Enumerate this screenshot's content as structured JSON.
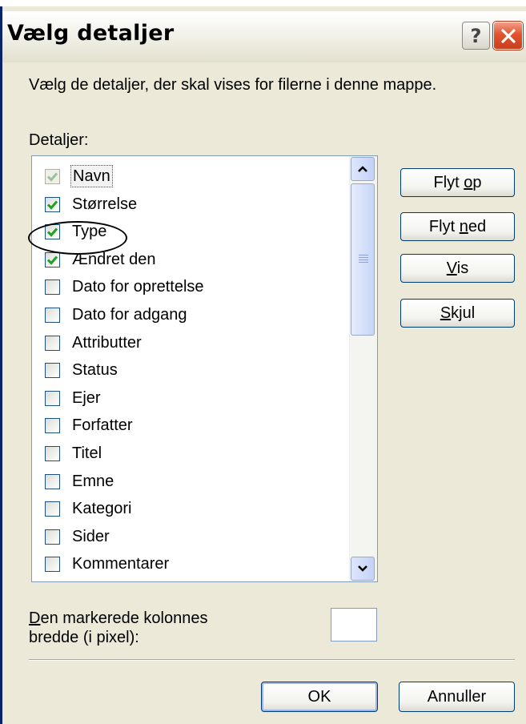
{
  "window": {
    "title": "Vælg detaljer",
    "help_label": "?",
    "close_icon": "close-icon"
  },
  "description": "Vælg de detaljer, der skal  vises for filerne i denne mappe.",
  "details_label": "Detaljer:",
  "details_list": [
    {
      "label": "Navn",
      "checked": true,
      "disabled": true,
      "selected": true
    },
    {
      "label": "Størrelse",
      "checked": true
    },
    {
      "label": "Type",
      "checked": true
    },
    {
      "label": "Ændret den",
      "checked": true
    },
    {
      "label": "Dato for oprettelse",
      "checked": false
    },
    {
      "label": "Dato for adgang",
      "checked": false
    },
    {
      "label": "Attributter",
      "checked": false
    },
    {
      "label": "Status",
      "checked": false
    },
    {
      "label": "Ejer",
      "checked": false
    },
    {
      "label": "Forfatter",
      "checked": false
    },
    {
      "label": "Titel",
      "checked": false
    },
    {
      "label": "Emne",
      "checked": false
    },
    {
      "label": "Kategori",
      "checked": false
    },
    {
      "label": "Sider",
      "checked": false
    },
    {
      "label": "Kommentarer",
      "checked": false
    },
    {
      "label": "",
      "checked": false
    }
  ],
  "buttons": {
    "move_up": {
      "before": "Flyt ",
      "key": "o",
      "after": "p"
    },
    "move_down": {
      "before": "Flyt ",
      "key": "n",
      "after": "ed"
    },
    "show": {
      "before": "",
      "key": "V",
      "after": "is"
    },
    "hide": {
      "before": "",
      "key": "S",
      "after": "kjul"
    },
    "ok": "OK",
    "cancel": "Annuller"
  },
  "width_field": {
    "label_key": "D",
    "label_rest": "en markerede kolonnes",
    "label_line2": "bredde (i pixel):",
    "value": ""
  },
  "colors": {
    "dialog_bg": "#ECE9D8",
    "check_green": "#21a121",
    "close_red": "#e2532c"
  }
}
